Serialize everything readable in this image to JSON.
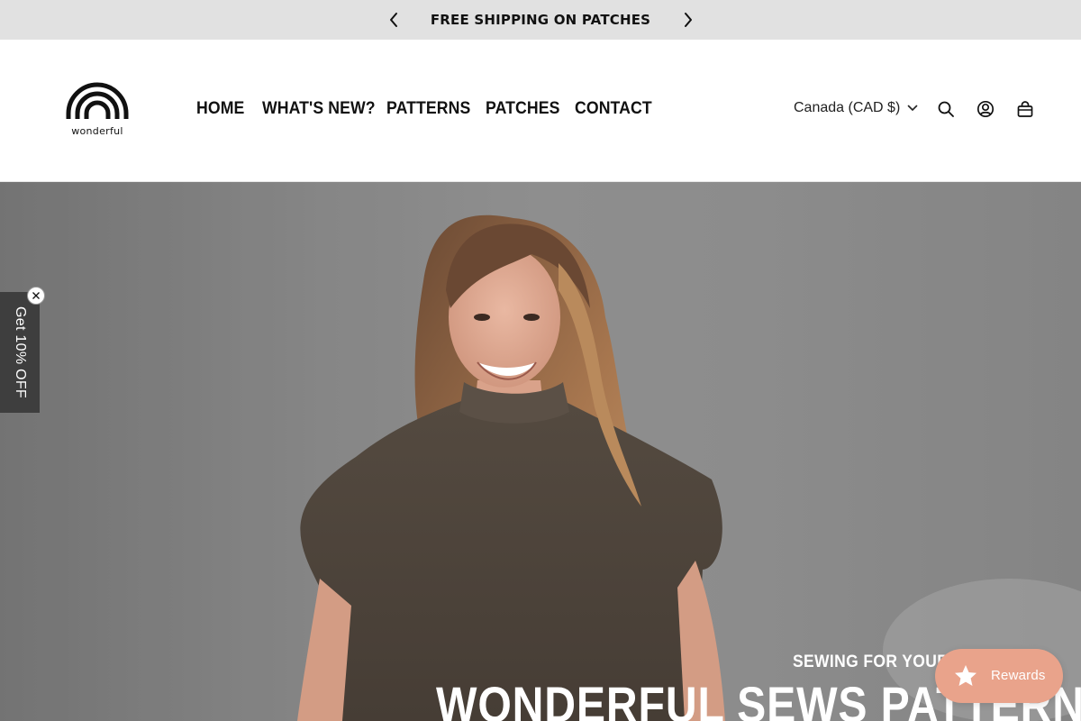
{
  "announcement": {
    "text": "FREE SHIPPING ON PATCHES",
    "prev_icon": "chevron-left-icon",
    "next_icon": "chevron-right-icon",
    "background": "#e1e1e1"
  },
  "header": {
    "logo_text": "wonderful",
    "nav": [
      {
        "label": "HOME"
      },
      {
        "label": "WHAT'S NEW?"
      },
      {
        "label": "PATTERNS"
      },
      {
        "label": "PATCHES"
      },
      {
        "label": "CONTACT"
      }
    ],
    "currency": "Canada (CAD $)",
    "icons": [
      "search-icon",
      "account-icon",
      "cart-icon"
    ]
  },
  "hero": {
    "eyebrow": "SEWING FOR YOUR B",
    "title": "WONDERFUL SEWS PATTERNS"
  },
  "discount_tab": {
    "label": "Get 10% OFF",
    "close_icon": "close-icon",
    "background": "#3e3e3e"
  },
  "rewards": {
    "label": "Rewards",
    "icon": "star-icon",
    "background": "#e9a38b"
  }
}
